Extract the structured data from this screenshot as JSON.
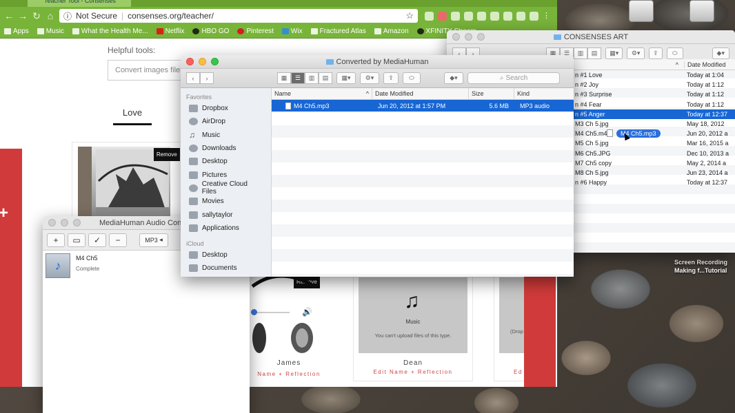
{
  "browser": {
    "tab_title": "Teacher Tool - Consenses",
    "not_secure": "Not Secure",
    "url": "consenses.org/teacher/",
    "bookmarks": [
      "Apps",
      "Music",
      "What the Health Me...",
      "Netflix",
      "HBO GO",
      "Pinterest",
      "Wix",
      "Fractured Atlas",
      "Amazon",
      "XFINITY Stream"
    ],
    "helpful_tools": "Helpful tools:",
    "convert_box": "Convert images files",
    "love_tab": "Love",
    "remove_label": "Remove",
    "cards": [
      {
        "name": "James",
        "link": "Name + Reflection"
      },
      {
        "name": "Dean",
        "link": "Edit Name + Reflection",
        "type_label": "Music",
        "error": "You can't upload files of this type."
      },
      {
        "name": "",
        "link": "Ed",
        "drop_hint": "(Drop"
      }
    ]
  },
  "mediahuman": {
    "title": "MediaHuman Audio Converter",
    "format": "MP3",
    "item": {
      "name": "M4 Ch5",
      "status": "Complete"
    }
  },
  "finder": {
    "title": "Converted by MediaHuman",
    "search_placeholder": "Search",
    "sidebar": {
      "favorites_label": "Favorites",
      "favorites": [
        "Dropbox",
        "AirDrop",
        "Music",
        "Downloads",
        "Desktop",
        "Pictures",
        "Creative Cloud Files",
        "Movies",
        "sallytaylor",
        "Applications"
      ],
      "icloud_label": "iCloud",
      "icloud": [
        "Desktop",
        "Documents"
      ]
    },
    "columns": [
      "Name",
      "Date Modified",
      "Size",
      "Kind"
    ],
    "rows": [
      {
        "name": "M4 Ch5.mp3",
        "date": "Jun 20, 2012 at 1:57 PM",
        "size": "5.6 MB",
        "kind": "MP3 audio"
      }
    ]
  },
  "finder2": {
    "title": "CONSENSES ART",
    "column_date": "Date Modified",
    "rows": [
      {
        "name": "n #1 Love",
        "date": "Today at 1:04"
      },
      {
        "name": "n #2 Joy",
        "date": "Today at 1:12"
      },
      {
        "name": "n #3 Surprise",
        "date": "Today at 1:12"
      },
      {
        "name": "n #4 Fear",
        "date": "Today at 1:12"
      },
      {
        "name": "n #5 Anger",
        "date": "Today at 12:37",
        "selected": true
      },
      {
        "name": "M3 Ch 5.jpg",
        "date": "May 18, 2012"
      },
      {
        "name": "M4 Ch5.m4a",
        "date": "Jun 20, 2012 a"
      },
      {
        "name": "M5 Ch 5.jpg",
        "date": "Mar 16, 2015 a"
      },
      {
        "name": "M6 Ch5.JPG",
        "date": "Dec 10, 2013 a"
      },
      {
        "name": "M7 Ch5 copy",
        "date": "May 2, 2014 a"
      },
      {
        "name": "M8 Ch 5.jpg",
        "date": "Jun 23, 2014 a"
      },
      {
        "name": "n #6 Happy",
        "date": "Today at 12:37"
      }
    ],
    "drag_label": "M4 Ch5.mp3"
  },
  "desktop": {
    "recording_label_1": "Screen Recording",
    "recording_label_2": "Making f...Tutorial"
  }
}
